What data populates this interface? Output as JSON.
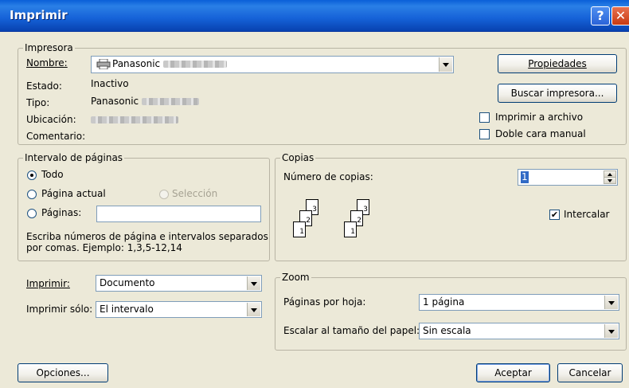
{
  "window": {
    "title": "Imprimir",
    "help_glyph": "?",
    "close_glyph": "✕"
  },
  "printer": {
    "legend": "Impresora",
    "name_label": "Nombre:",
    "name_value": "Panasonic",
    "status_label": "Estado:",
    "status_value": "Inactivo",
    "type_label": "Tipo:",
    "type_value": "Panasonic",
    "location_label": "Ubicación:",
    "comment_label": "Comentario:",
    "properties_button": "Propiedades",
    "find_printer_button": "Buscar impresora...",
    "print_to_file_label": "Imprimir a archivo",
    "duplex_label": "Doble cara manual"
  },
  "page_range": {
    "legend": "Intervalo de páginas",
    "all_label": "Todo",
    "current_label": "Página actual",
    "selection_label": "Selección",
    "pages_label": "Páginas:",
    "pages_value": "",
    "help_line1": "Escriba números de página e intervalos separados",
    "help_line2": "por comas. Ejemplo: 1,3,5-12,14"
  },
  "copies": {
    "legend": "Copias",
    "count_label": "Número de copias:",
    "count_value": "1",
    "collate_label": "Intercalar",
    "collate_checked": true,
    "stack_a": [
      "3",
      "2",
      "1"
    ],
    "stack_b": [
      "3",
      "2",
      "1"
    ]
  },
  "print_what": {
    "print_label": "Imprimir:",
    "print_value": "Documento",
    "print_only_label": "Imprimir sólo:",
    "print_only_value": "El intervalo"
  },
  "zoom": {
    "legend": "Zoom",
    "pages_per_sheet_label": "Páginas por hoja:",
    "pages_per_sheet_value": "1 página",
    "scale_label": "Escalar al tamaño del papel:",
    "scale_value": "Sin escala"
  },
  "footer": {
    "options_button": "Opciones...",
    "ok_button": "Aceptar",
    "cancel_button": "Cancelar"
  }
}
